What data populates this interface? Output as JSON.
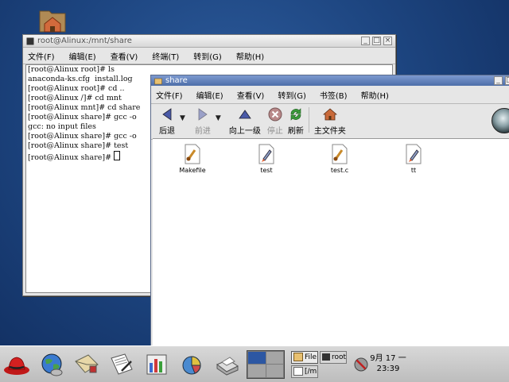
{
  "terminal": {
    "title": "root@Alinux:/mnt/share",
    "menu": [
      "文件(F)",
      "编辑(E)",
      "查看(V)",
      "终端(T)",
      "转到(G)",
      "帮助(H)"
    ],
    "lines": [
      "[root@Alinux root]# ls",
      "anaconda-ks.cfg  install.log",
      "[root@Alinux root]# cd ..",
      "[root@Alinux /]# cd mnt",
      "[root@Alinux mnt]# cd share",
      "[root@Alinux share]# gcc -o",
      "gcc: no input files",
      "[root@Alinux share]# gcc -o",
      "[root@Alinux share]# test",
      "[root@Alinux share]# "
    ]
  },
  "nautilus": {
    "title": "share",
    "menu": [
      "文件(F)",
      "编辑(E)",
      "查看(V)",
      "转到(G)",
      "书签(B)",
      "帮助(H)"
    ],
    "toolbar": {
      "back": "后退",
      "forward": "前进",
      "up": "向上一级",
      "stop": "停止",
      "refresh": "刷新",
      "home": "主文件夹"
    },
    "files": [
      "Makefile",
      "test",
      "test.c",
      "tt"
    ]
  },
  "panel": {
    "tasks": [
      "File",
      "root",
      "[/m"
    ],
    "clock_date": "9月 17 一",
    "clock_time": "23:39"
  },
  "colors": {
    "desktop": "#1d4580",
    "nautilus_titlebar": "#5b7bb5",
    "pager_active": "#2c57a3"
  }
}
